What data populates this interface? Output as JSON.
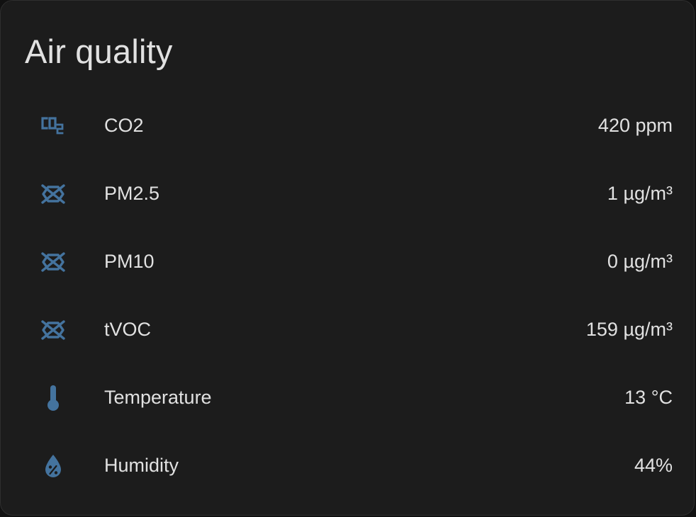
{
  "card": {
    "title": "Air quality"
  },
  "accent_color": "#44739e",
  "rows": [
    {
      "icon": "molecule-co2-icon",
      "label": "CO2",
      "value": "420 ppm"
    },
    {
      "icon": "molecule-icon",
      "label": "PM2.5",
      "value": "1 µg/m³"
    },
    {
      "icon": "molecule-icon",
      "label": "PM10",
      "value": "0 µg/m³"
    },
    {
      "icon": "molecule-icon",
      "label": "tVOC",
      "value": "159 µg/m³"
    },
    {
      "icon": "thermometer-icon",
      "label": "Temperature",
      "value": "13 °C"
    },
    {
      "icon": "water-percent-icon",
      "label": "Humidity",
      "value": "44%"
    }
  ]
}
